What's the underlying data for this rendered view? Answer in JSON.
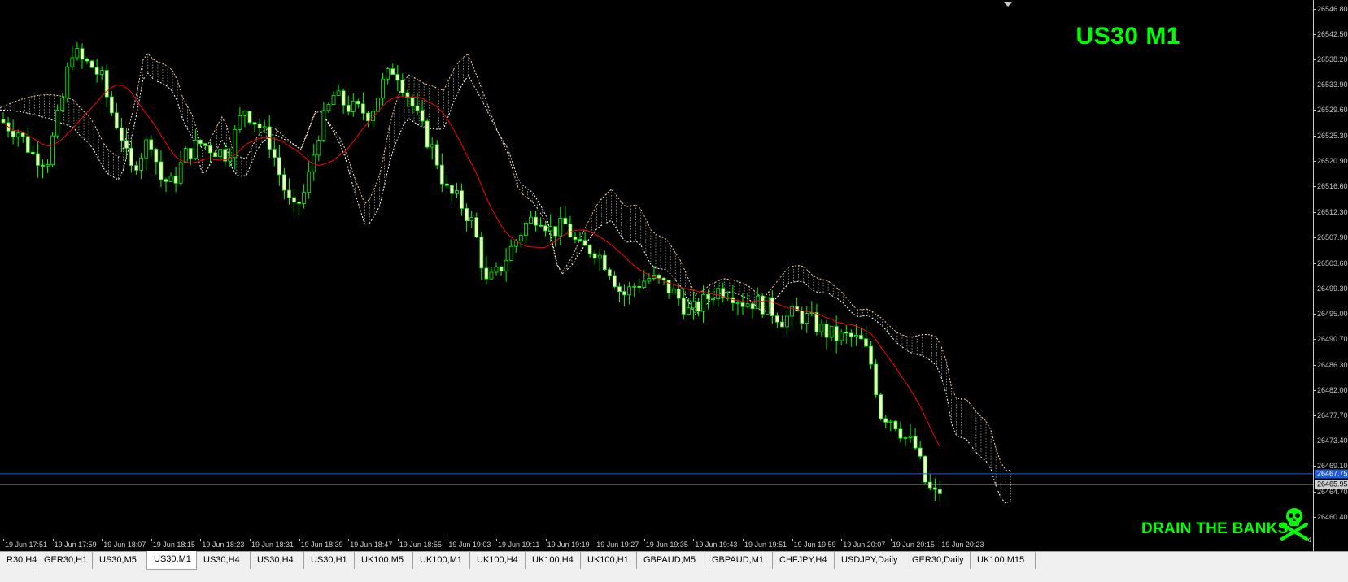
{
  "chart": {
    "title": "US30 M1",
    "slogan": "DRAIN THE BANKS",
    "price_labels": [
      "26546.80",
      "26542.50",
      "26538.20",
      "26533.90",
      "26529.60",
      "26525.30",
      "26520.90",
      "26516.60",
      "26512.30",
      "26507.90",
      "26503.60",
      "26499.30",
      "26495.00",
      "26490.70",
      "26486.30",
      "26482.00",
      "26477.70",
      "26473.40",
      "26469.10",
      "26464.70",
      "26460.40"
    ],
    "time_labels": [
      "19 Jun 17:51",
      "19 Jun 17:59",
      "19 Jun 18:07",
      "19 Jun 18:15",
      "19 Jun 18:23",
      "19 Jun 18:31",
      "19 Jun 18:39",
      "19 Jun 18:47",
      "19 Jun 18:55",
      "19 Jun 19:03",
      "19 Jun 19:11",
      "19 Jun 19:19",
      "19 Jun 19:27",
      "19 Jun 19:35",
      "19 Jun 19:43",
      "19 Jun 19:51",
      "19 Jun 19:59",
      "19 Jun 20:07",
      "19 Jun 20:15",
      "19 Jun 20:23"
    ],
    "current_price_blue": "26467.75",
    "current_price_gray": "26465.95",
    "colors": {
      "background": "#000000",
      "candle_body": "#ffffcc",
      "candle_wick": "#00ff00",
      "moving_average": "#ff0000",
      "cloud": "#ffcc99",
      "price_line_blue": "#1e5bd8",
      "price_line_gray": "#cfcfcf",
      "text_green": "#00ff00"
    },
    "skull_icon": "skull-and-crossbones-icon"
  },
  "tabs": [
    {
      "label": "R30,H4",
      "active": false
    },
    {
      "label": "GER30,H1",
      "active": false
    },
    {
      "label": "US30,M5",
      "active": false
    },
    {
      "label": "US30,M1",
      "active": true
    },
    {
      "label": "US30,H4",
      "active": false
    },
    {
      "label": "US30,H4",
      "active": false
    },
    {
      "label": "US30,H1",
      "active": false
    },
    {
      "label": "UK100,M5",
      "active": false
    },
    {
      "label": "UK100,M1",
      "active": false
    },
    {
      "label": "UK100,H4",
      "active": false
    },
    {
      "label": "UK100,H4",
      "active": false
    },
    {
      "label": "UK100,H1",
      "active": false
    },
    {
      "label": "GBPAUD,M5",
      "active": false
    },
    {
      "label": "GBPAUD,M1",
      "active": false
    },
    {
      "label": "CHFJPY,H4",
      "active": false
    },
    {
      "label": "USDJPY,Daily",
      "active": false
    },
    {
      "label": "GER30,Daily",
      "active": false
    },
    {
      "label": "UK100,M15",
      "active": false
    }
  ]
}
